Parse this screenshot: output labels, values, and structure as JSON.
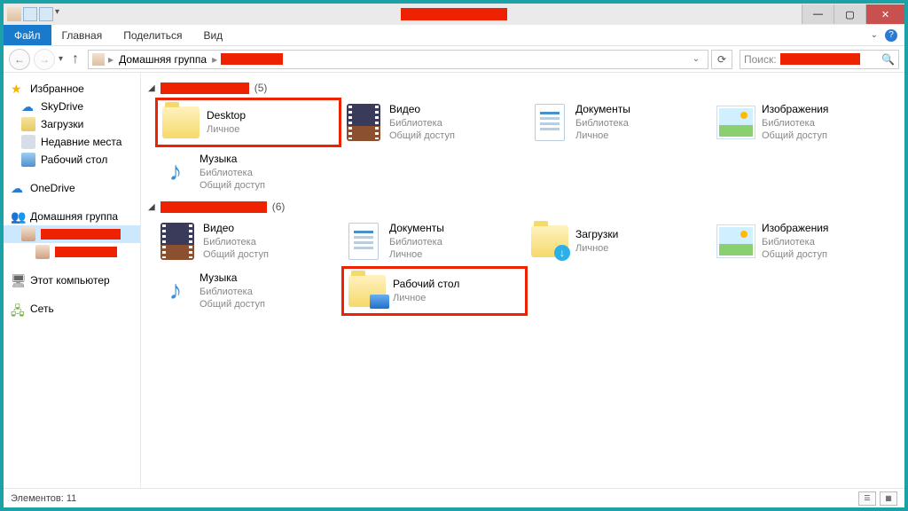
{
  "ribbon": {
    "file": "Файл",
    "home": "Главная",
    "share": "Поделиться",
    "view": "Вид"
  },
  "breadcrumb": {
    "homegroup": "Домашняя группа"
  },
  "search": {
    "placeholder": "Поиск:"
  },
  "nav": {
    "favorites": "Избранное",
    "skydrive": "SkyDrive",
    "downloads": "Загрузки",
    "recent": "Недавние места",
    "desktop": "Рабочий стол",
    "onedrive": "OneDrive",
    "homegroup": "Домашняя группа",
    "thispc": "Этот компьютер",
    "network": "Сеть"
  },
  "groups": [
    {
      "count": "(5)",
      "items": [
        {
          "name": "Desktop",
          "sub1": "Личное",
          "sub2": "",
          "icon": "folder",
          "highlight": true
        },
        {
          "name": "Видео",
          "sub1": "Библиотека",
          "sub2": "Общий доступ",
          "icon": "video"
        },
        {
          "name": "Документы",
          "sub1": "Библиотека",
          "sub2": "Личное",
          "icon": "doc"
        },
        {
          "name": "Изображения",
          "sub1": "Библиотека",
          "sub2": "Общий доступ",
          "icon": "image"
        },
        {
          "name": "Музыка",
          "sub1": "Библиотека",
          "sub2": "Общий доступ",
          "icon": "music"
        }
      ]
    },
    {
      "count": "(6)",
      "items": [
        {
          "name": "Видео",
          "sub1": "Библиотека",
          "sub2": "Общий доступ",
          "icon": "video"
        },
        {
          "name": "Документы",
          "sub1": "Библиотека",
          "sub2": "Личное",
          "icon": "doc"
        },
        {
          "name": "Загрузки",
          "sub1": "Личное",
          "sub2": "",
          "icon": "folder-downloads"
        },
        {
          "name": "Изображения",
          "sub1": "Библиотека",
          "sub2": "Общий доступ",
          "icon": "image"
        },
        {
          "name": "Музыка",
          "sub1": "Библиотека",
          "sub2": "Общий доступ",
          "icon": "music"
        },
        {
          "name": "Рабочий стол",
          "sub1": "Личное",
          "sub2": "",
          "icon": "folder-desktop",
          "highlight": true
        }
      ]
    }
  ],
  "status": {
    "items_label": "Элементов:",
    "items_count": "11"
  }
}
